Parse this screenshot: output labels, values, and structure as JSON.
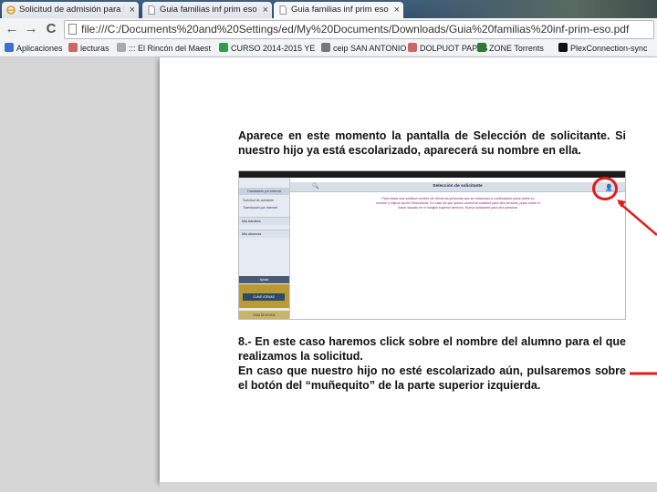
{
  "browser": {
    "tabs": [
      {
        "label": "Solicitud de admisión para En",
        "icon": "ie-icon",
        "active": false
      },
      {
        "label": "Guia familias inf prim eso pdf",
        "icon": "document-icon",
        "active": false
      },
      {
        "label": "Guia familias inf prim eso pdf",
        "icon": "document-icon",
        "active": true
      }
    ],
    "close_glyph": "×",
    "back_glyph": "←",
    "forward_glyph": "→",
    "reload_glyph": "C",
    "url": "file:///C:/Documents%20and%20Settings/ed/My%20Documents/Downloads/Guia%20familias%20inf-prim-eso.pdf",
    "bookmarks": [
      {
        "label": "Aplicaciones",
        "icon": "apps-icon",
        "color": "#3c6fd0"
      },
      {
        "label": "lecturas",
        "icon": "bookmark-icon",
        "color": "#c66"
      },
      {
        "label": "::: El Rincón del Maest",
        "icon": "bookmark-icon",
        "color": "#aaa"
      },
      {
        "label": "CURSO 2014-2015 YE",
        "icon": "drive-icon",
        "color": "#2f9e4f"
      },
      {
        "label": "ceip SAN ANTONIO",
        "icon": "school-icon",
        "color": "#777"
      },
      {
        "label": "DOLPUOT PAPAS",
        "icon": "bookmark-icon",
        "color": "#c66"
      },
      {
        "label": "ZONE Torrents",
        "icon": "torrent-icon",
        "color": "#2c7a33"
      },
      {
        "label": "PlexConnection-sync",
        "icon": "plex-icon",
        "color": "#111"
      }
    ]
  },
  "document": {
    "paragraph1": "Aparece en este momento la pantalla de Selección de solicitante. Si nuestro hijo ya está escolarizado, aparecerá su nombre en ella.",
    "paragraph2_line1": "8.- En este caso haremos click sobre el nombre del alumno para el que realizamos la solicitud.",
    "paragraph2_line2": "En caso que nuestro hijo no esté escolarizado aún, pulsaremos sobre el botón del “muñequito” de la parte superior izquierda.",
    "screenshot": {
      "sidebar_header": "Tramitación por internet",
      "sidebar_items": [
        "Solicitud de admisión",
        "Tramitación por internet"
      ],
      "sidebar_bands": [
        "Mis trámites",
        "Mis alumnos"
      ],
      "help_label": "Ayuda",
      "gold_button": "CLAVE ATENAS",
      "gold_bottom": "GUIA DE AYUDA",
      "title": "Selección de solicitante",
      "message": "Para iniciar una solicitud nombre de niño/a las personas que se relacionan a continuación pulse sobre su nombre y elija la opción Seleccionar. En caso de que quiera comenzar solicitud para otra persona, pulse sobre el botón situado en el margen superior derecho. Nuevo solicitante para otra persona.",
      "search_glyph": "🔍",
      "person_glyph": "👤"
    }
  },
  "colors": {
    "annotation": "#e21b1b",
    "tab_strip": "#2f4c69",
    "gold": "#b99a36"
  }
}
